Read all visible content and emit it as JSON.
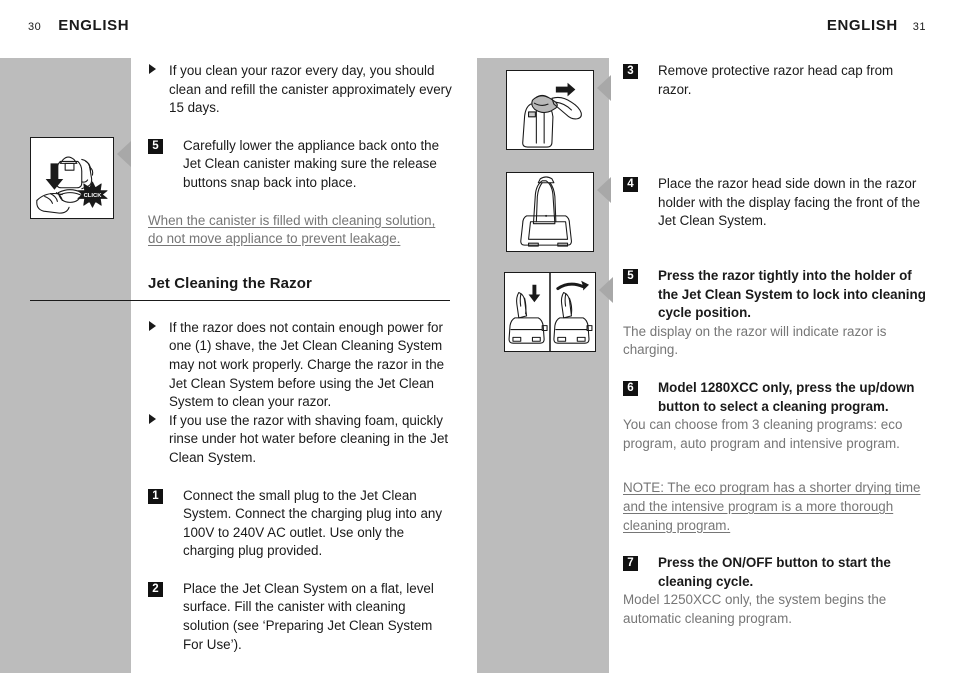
{
  "page": {
    "left_running_head": "ENGLISH",
    "left_folio": "30",
    "right_running_head": "ENGLISH",
    "right_folio": "31",
    "accent_gray": "#bcbcbc",
    "note_gray": "#767676",
    "ink": "#1a1a1a"
  },
  "left_column": {
    "bullet_1": "If you clean your razor every day, you should clean and refill the canister approximately every 15 days.",
    "step_5_number": "5",
    "step_5_text": "Carefully lower the appliance back onto the Jet Clean canister making sure the release buttons snap back into place.",
    "note_leakage_main": "When the canister is filled with cleaning solution, do not move appliance to prevent leakage",
    "note_leakage_tail": ".",
    "section_heading": "Jet Cleaning the Razor",
    "bullet_2": "If the razor does not contain enough power for one (1) shave, the Jet Clean Cleaning System may not work properly.  Charge the razor in the Jet Clean System before using the Jet Clean System to clean your razor.",
    "bullet_3": "If you use the razor with shaving foam, quickly rinse under hot water before cleaning in the Jet Clean System.",
    "step_1_number": "1",
    "step_1_text": "Connect the small plug to the Jet Clean System.  Connect the charging plug into any 100V to 240V AC outlet.  Use only the charging plug provided.",
    "step_2_number": "2",
    "step_2_text": "Place the Jet Clean System on a flat, level surface.  Fill the canister with cleaning solution (see ‘Preparing Jet Clean System For Use’)."
  },
  "right_column": {
    "step_3_number": "3",
    "step_3_text": "Remove protective razor head cap from razor.",
    "step_4_number": "4",
    "step_4_text": "Place the razor head side down in the razor holder with the display facing the front of the Jet Clean System.",
    "step_5_number": "5",
    "step_5_text": "Press the razor tightly into the holder of the Jet Clean System to lock into cleaning cycle position.",
    "note_charging": "The display on the razor will indicate razor is charging.",
    "step_6_number": "6",
    "step_6_text": "Model 1280XCC only, press the up/down button to select a cleaning program.",
    "note_programs": "You can choose from 3 cleaning programs: eco program, auto program and intensive program.",
    "note_eco_main": "NOTE: The eco program has a shorter drying time and the intensive program is a more thorough cleaning program",
    "note_eco_tail": ".",
    "step_7_number": "7",
    "step_7_text": "Press the ON/OFF button to start the cleaning cycle.",
    "note_automatic": "Model 1250XCC only, the system begins the automatic cleaning program."
  },
  "figures": {
    "click_illustration": "hands-lowering-appliance-click-illustration",
    "cap_illustration": "remove-razor-head-cap-illustration",
    "holder_illustration": "razor-in-holder-illustration",
    "press_illustration": "press-razor-into-holder-illustration"
  }
}
